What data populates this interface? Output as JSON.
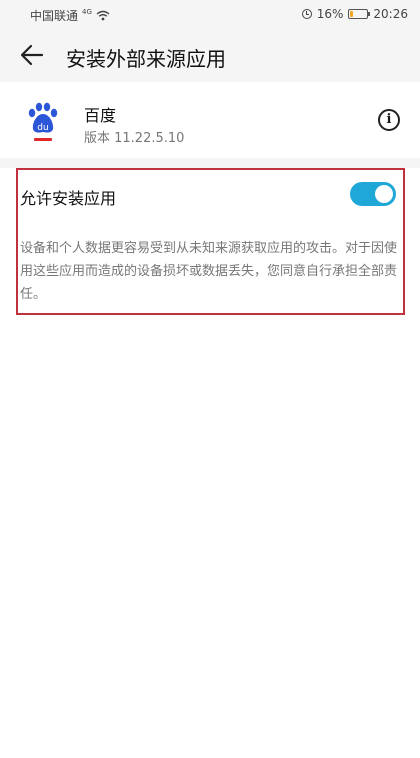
{
  "status_bar": {
    "carrier": "中国联通",
    "network_badge": "4G",
    "battery_percent": "16%",
    "battery_level": 0.16,
    "time": "20:26",
    "icons": [
      "signal-icon",
      "wifi-icon",
      "alarm-icon",
      "battery-icon"
    ]
  },
  "header": {
    "title": "安装外部来源应用",
    "back_icon": "back-arrow-icon"
  },
  "app": {
    "name": "百度",
    "version": "版本 11.22.5.10",
    "icon": "baidu-paw-icon",
    "info_icon": "info-icon",
    "info_glyph": "i"
  },
  "setting": {
    "label": "允许安装应用",
    "enabled": true,
    "warning": "设备和个人数据更容易受到从未知来源获取应用的攻击。对于因使用这些应用而造成的设备损坏或数据丢失，您同意自行承担全部责任。"
  },
  "colors": {
    "accent": "#1fa7d8",
    "highlight_border": "#c0303d",
    "brand_blue": "#2b56d8",
    "brand_red": "#e0282c"
  }
}
